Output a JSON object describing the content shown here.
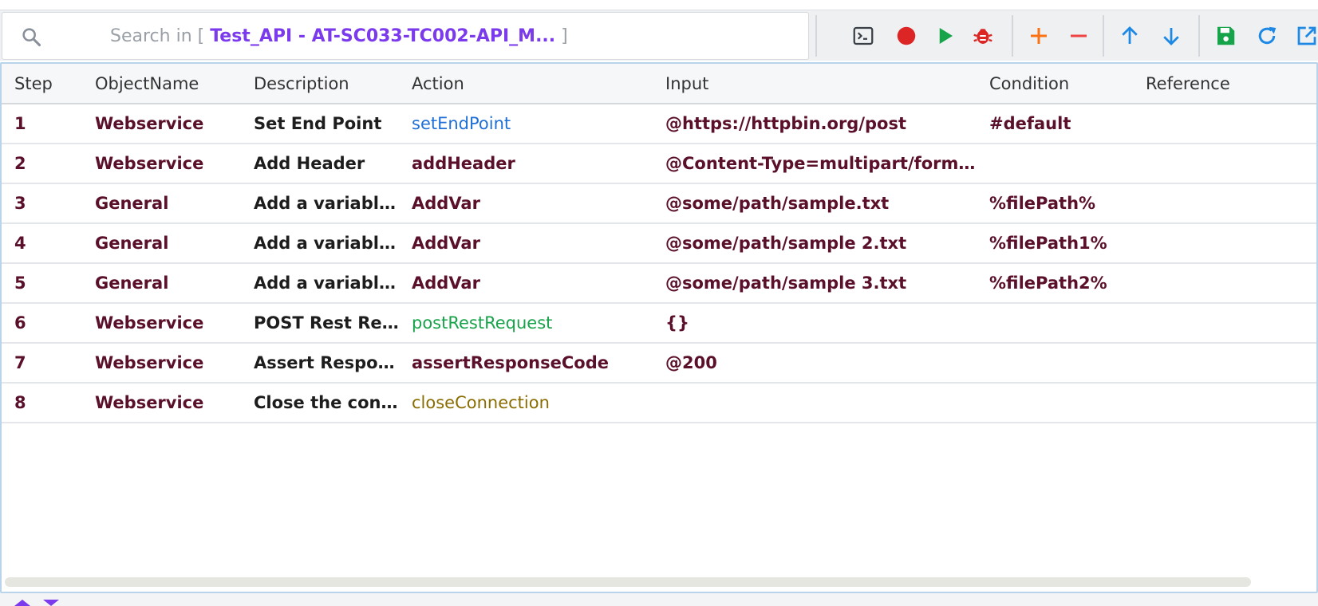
{
  "search": {
    "prefix": "Search in [ ",
    "scope": "Test_API - AT-SC033-TC002-API_M...",
    "suffix": " ]"
  },
  "toolbar": {
    "colors": {
      "record": "#dc2626",
      "run": "#16a34a",
      "debug": "#dc2626",
      "add": "#f97316",
      "remove": "#ef4444",
      "move": "#1e88e5",
      "save": "#16a34a",
      "refresh": "#1e88e5",
      "open": "#1e88e5"
    },
    "icons": [
      "console-icon",
      "record-icon",
      "play-icon",
      "bug-icon",
      "plus-icon",
      "minus-icon",
      "arrow-up-icon",
      "arrow-down-icon",
      "save-icon",
      "refresh-icon",
      "external-link-icon"
    ]
  },
  "grid": {
    "columns": [
      "Step",
      "ObjectName",
      "Description",
      "Action",
      "Input",
      "Condition",
      "Reference"
    ],
    "rows": [
      {
        "step": "1",
        "object": "Webservice",
        "description": "Set End Point",
        "action": "setEndPoint",
        "action_color": "blue",
        "input": "@https://httpbin.org/post",
        "condition": "#default",
        "reference": ""
      },
      {
        "step": "2",
        "object": "Webservice",
        "description": "Add Header",
        "action": "addHeader",
        "action_color": "default",
        "input": "@Content-Type=multipart/form-data",
        "condition": "",
        "reference": ""
      },
      {
        "step": "3",
        "object": "General",
        "description": "Add a variable t...",
        "action": "AddVar",
        "action_color": "default",
        "input": "@some/path/sample.txt",
        "condition": "%filePath%",
        "reference": ""
      },
      {
        "step": "4",
        "object": "General",
        "description": "Add a variable t...",
        "action": "AddVar",
        "action_color": "default",
        "input": "@some/path/sample 2.txt",
        "condition": "%filePath1%",
        "reference": ""
      },
      {
        "step": "5",
        "object": "General",
        "description": "Add a variable t...",
        "action": "AddVar",
        "action_color": "default",
        "input": "@some/path/sample 3.txt",
        "condition": "%filePath2%",
        "reference": ""
      },
      {
        "step": "6",
        "object": "Webservice",
        "description": "POST Rest Req...",
        "action": "postRestRequest",
        "action_color": "green",
        "input": "{}",
        "condition": "",
        "reference": ""
      },
      {
        "step": "7",
        "object": "Webservice",
        "description": "Assert Respons...",
        "action": "assertResponseCode",
        "action_color": "default",
        "input": "@200",
        "condition": "",
        "reference": ""
      },
      {
        "step": "8",
        "object": "Webservice",
        "description": "Close the conne...",
        "action": "closeConnection",
        "action_color": "olive",
        "input": "",
        "condition": "",
        "reference": ""
      }
    ]
  }
}
